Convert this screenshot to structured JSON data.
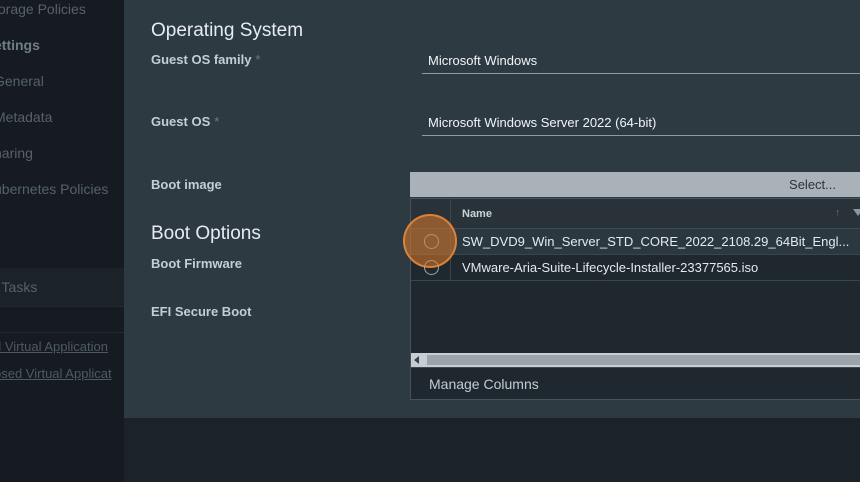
{
  "sidebar": {
    "items": [
      {
        "label": "torage Policies",
        "style": "normal"
      },
      {
        "label": "ettings",
        "style": "bold"
      },
      {
        "label": "General",
        "style": "normal"
      },
      {
        "label": "Metadata",
        "style": "normal"
      },
      {
        "label": "haring",
        "style": "normal"
      },
      {
        "label": "ubernetes Policies",
        "style": "normal"
      }
    ],
    "tasks_label": "t Tasks",
    "links": [
      "d Virtual Application",
      "osed Virtual Applicat"
    ]
  },
  "operating_system": {
    "title": "Operating System",
    "guest_os_family": {
      "label": "Guest OS family",
      "required_mark": "*",
      "value": "Microsoft Windows"
    },
    "guest_os": {
      "label": "Guest OS",
      "required_mark": "*",
      "value": "Microsoft Windows Server 2022 (64-bit)"
    },
    "boot_image": {
      "label": "Boot image",
      "select_label": "Select..."
    }
  },
  "boot_options": {
    "title": "Boot Options",
    "boot_firmware_label": "Boot Firmware",
    "efi_secure_boot_label": "EFI Secure Boot"
  },
  "dropdown": {
    "column_name": "Name",
    "rows": [
      {
        "name": "SW_DVD9_Win_Server_STD_CORE_2022_2108.29_64Bit_Engl..."
      },
      {
        "name": "VMware-Aria-Suite-Lifecycle-Installer-23377565.iso"
      }
    ],
    "manage_columns": "Manage Columns"
  },
  "colors": {
    "panel_bg": "#2d3a42",
    "page_bg": "#1b2228",
    "highlight": "#de7a2a"
  }
}
